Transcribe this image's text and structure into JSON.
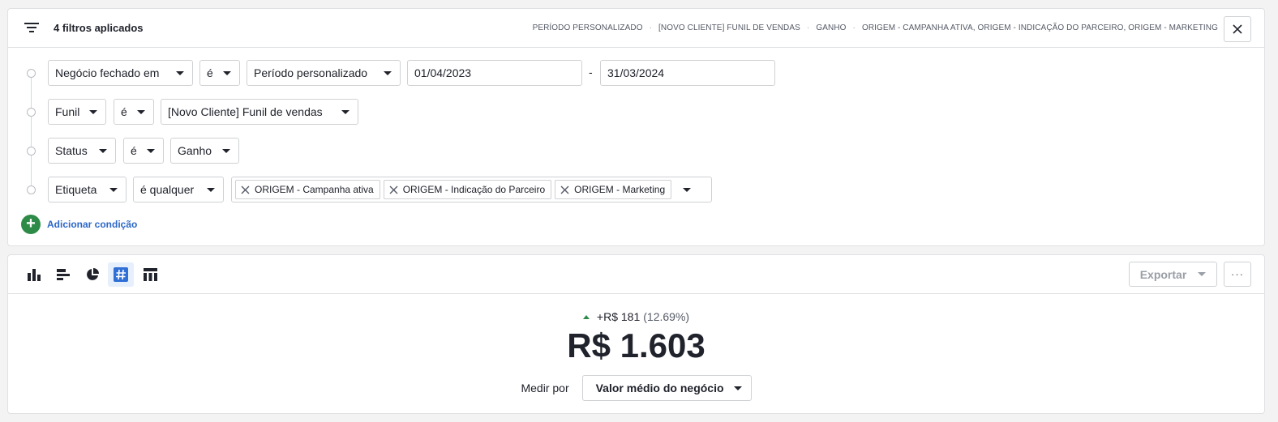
{
  "filters": {
    "count_label": "4 filtros aplicados",
    "summary": [
      "PERÍODO PERSONALIZADO",
      "[NOVO CLIENTE] FUNIL DE VENDAS",
      "GANHO",
      "ORIGEM - CAMPANHA ATIVA, ORIGEM - INDICAÇÃO DO PARCEIRO, ORIGEM - MARKETING"
    ],
    "summary_separator": "·",
    "conditions": {
      "c1": {
        "field": "Negócio fechado em",
        "operator": "é",
        "period": "Período personalizado",
        "date_from": "01/04/2023",
        "date_separator": "-",
        "date_to": "31/03/2024"
      },
      "c2": {
        "field": "Funil",
        "operator": "é",
        "value": "[Novo Cliente] Funil de vendas"
      },
      "c3": {
        "field": "Status",
        "operator": "é",
        "value": "Ganho"
      },
      "c4": {
        "field": "Etiqueta",
        "operator": "é qualquer",
        "tags": [
          "ORIGEM - Campanha ativa",
          "ORIGEM - Indicação do Parceiro",
          "ORIGEM - Marketing"
        ]
      }
    },
    "add_condition_label": "Adicionar condição"
  },
  "view": {
    "icons": [
      "bar-chart-icon",
      "horizontal-bar-icon",
      "pie-chart-icon",
      "number-icon",
      "table-icon"
    ],
    "active_view": "number",
    "export_label": "Exportar",
    "more_label": "···",
    "metric": {
      "delta_value": "+R$ 181",
      "delta_percent": "(12.69%)",
      "value": "R$ 1.603"
    },
    "measure_label": "Medir por",
    "measure_value": "Valor médio do negócio"
  },
  "colors": {
    "accent_green": "#2e8b47",
    "link_blue": "#2c67c8",
    "active_view_bg": "#e6effc",
    "active_view_icon": "#2f6fd6"
  }
}
